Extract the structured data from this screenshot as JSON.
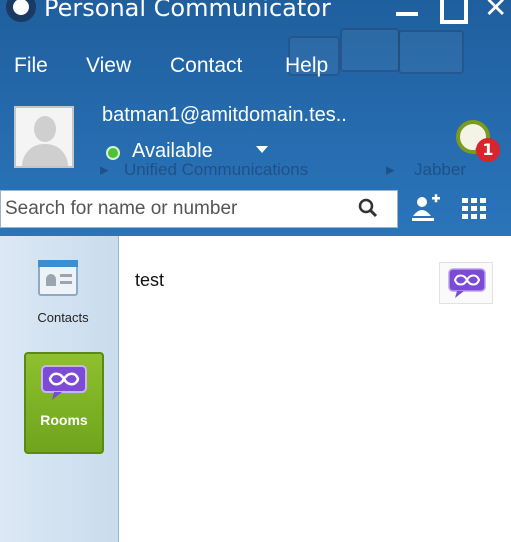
{
  "window": {
    "title": "Personal Communicator"
  },
  "menu": {
    "file": "File",
    "view": "View",
    "contact": "Contact",
    "help": "Help"
  },
  "profile": {
    "email": "batman1@amitdomain.tes..",
    "status": "Available",
    "status_color": "#4cc23a"
  },
  "breadcrumb": {
    "chevron1": "▸",
    "item1": "Unified Communications",
    "chevron2": "▸",
    "item2": "Jabber"
  },
  "notifications": {
    "count": "1"
  },
  "search": {
    "placeholder": "Search for name or number"
  },
  "rail": {
    "contacts_label": "Contacts",
    "rooms_label": "Rooms"
  },
  "rooms": [
    {
      "name": "test"
    }
  ],
  "colors": {
    "accent": "#2a73b8",
    "rooms_green": "#7fb228",
    "chat_purple": "#7c4bd6"
  }
}
